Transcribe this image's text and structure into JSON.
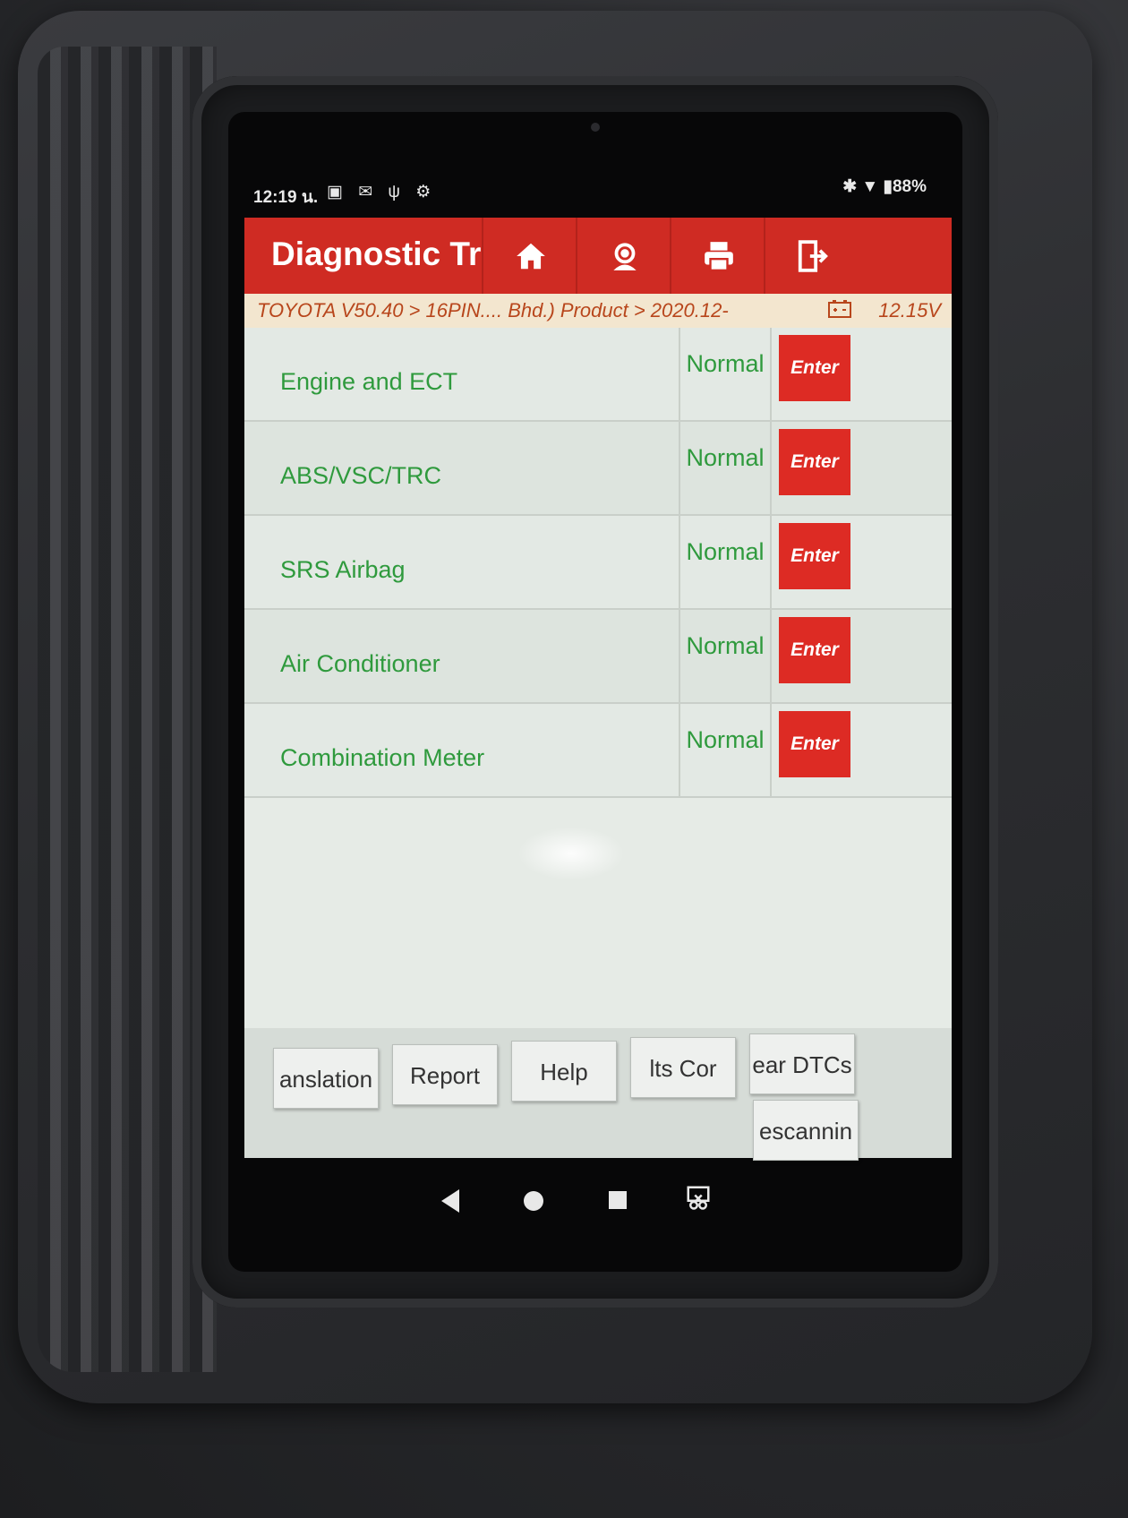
{
  "status_bar": {
    "time": "12:19 น.",
    "notifications": "▣ ✉ ψ ⚙",
    "right": "✱ ▼ ▮88%"
  },
  "header": {
    "title": "Diagnostic Tr",
    "buttons": [
      "home-icon",
      "support-icon",
      "print-icon",
      "exit-icon"
    ]
  },
  "breadcrumb": {
    "path": "TOYOTA V50.40 > 16PIN.... Bhd.) Product > 2020.12-",
    "voltage": "12.15V"
  },
  "systems": [
    {
      "name": "Engine and ECT",
      "status": "Normal",
      "action": "Enter"
    },
    {
      "name": "ABS/VSC/TRC",
      "status": "Normal",
      "action": "Enter"
    },
    {
      "name": "SRS Airbag",
      "status": "Normal",
      "action": "Enter"
    },
    {
      "name": "Air Conditioner",
      "status": "Normal",
      "action": "Enter"
    },
    {
      "name": "Combination Meter",
      "status": "Normal",
      "action": "Enter"
    }
  ],
  "footer": {
    "translation": "anslation",
    "report": "Report",
    "help": "Help",
    "results": "lts     Cor",
    "clear_dtcs": "ear DTCs",
    "rescanning": "escannin"
  },
  "colors": {
    "header": "#cf2b23",
    "enter_button": "#dd2b24",
    "status_text": "#2f9a3d",
    "breadcrumb_text": "#b8461c"
  }
}
